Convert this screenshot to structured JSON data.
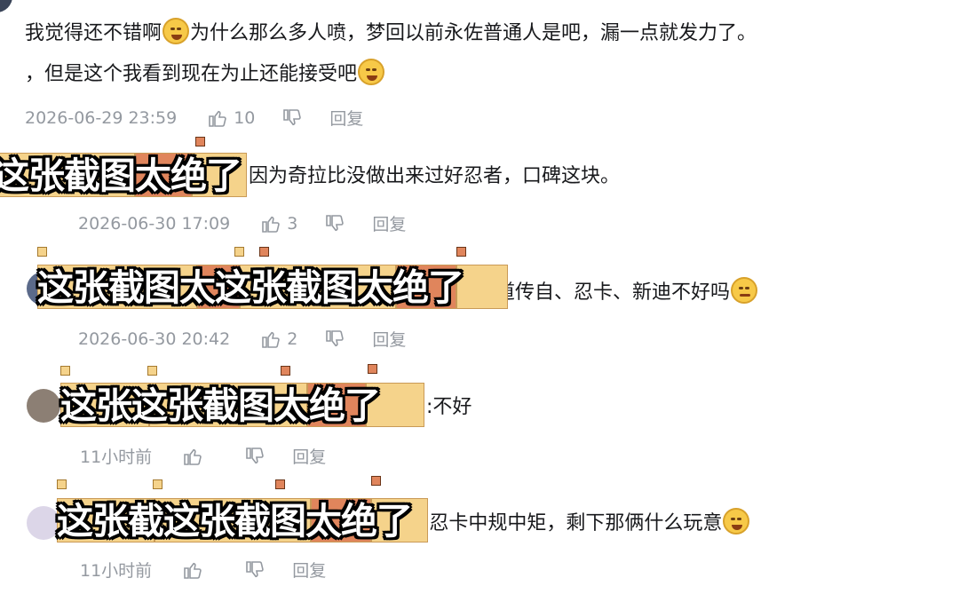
{
  "comments": [
    {
      "text_line1": "我觉得还不错啊",
      "text_line1b": "为什么那么多人喷，梦回以前永佐普通人是吧，漏一点就发力了。",
      "text_line2": "，但是这个我看到现在为止还能接受吧",
      "time": "2026-06-29 23:59",
      "likes": "10",
      "reply": "回复"
    },
    {
      "text": "因为奇拉比没做出来过好忍者，口碑这块。",
      "time": "2026-06-30 17:09",
      "likes": "3",
      "reply": "回复"
    },
    {
      "text": "难道传自、忍卡、新迪不好吗",
      "time": "2026-06-30 20:42",
      "likes": "2",
      "reply": "回复"
    },
    {
      "text": ":不好",
      "time": "11小时前",
      "likes": "",
      "reply": "回复"
    },
    {
      "text": ":忍卡中规中矩，剩下那俩什么玩意",
      "time": "11小时前",
      "likes": "",
      "reply": "回复"
    }
  ],
  "stickers": [
    {
      "label": "这张截图太绝了"
    },
    {
      "label": "这张截图太这张截图太绝了"
    },
    {
      "label": "这张这张截图太绝了"
    },
    {
      "label": "这张截这张截图太绝了"
    }
  ],
  "icons": {
    "like": "thumbs-up-icon",
    "dislike": "thumbs-down-icon"
  },
  "colors": {
    "meta": "#9499a0",
    "sticker_yellow": "#f5d38b",
    "sticker_orange": "#e0855c"
  }
}
